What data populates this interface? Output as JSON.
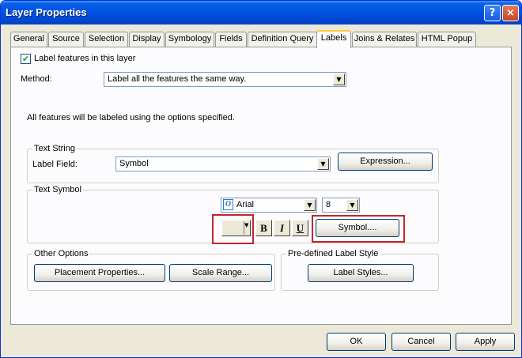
{
  "window": {
    "title": "Layer Properties"
  },
  "titlebar_buttons": {
    "help": "?",
    "close": "×"
  },
  "tabs": [
    {
      "label": "General"
    },
    {
      "label": "Source"
    },
    {
      "label": "Selection"
    },
    {
      "label": "Display"
    },
    {
      "label": "Symbology"
    },
    {
      "label": "Fields"
    },
    {
      "label": "Definition Query"
    },
    {
      "label": "Labels",
      "active": true
    },
    {
      "label": "Joins & Relates"
    },
    {
      "label": "HTML Popup"
    }
  ],
  "labels_tab": {
    "label_features": {
      "label": "Label features in this layer",
      "checked": true,
      "check_glyph": "✔"
    },
    "method": {
      "label": "Method:",
      "value": "Label all the features the same way."
    },
    "info_text": "All features will be labeled using the options specified.",
    "text_string": {
      "title": "Text String",
      "label_field_label": "Label Field:",
      "label_field_value": "Symbol",
      "expression_button": "Expression..."
    },
    "text_symbol": {
      "title": "Text Symbol",
      "font_value": "Arial",
      "font_icon": "O",
      "size_value": "8",
      "bold": "B",
      "italic": "I",
      "underline": "U",
      "symbol_button": "Symbol...."
    },
    "other_options": {
      "title": "Other Options",
      "placement_button": "Placement Properties...",
      "scale_button": "Scale Range..."
    },
    "predefined": {
      "title": "Pre-defined Label Style",
      "label_styles_button": "Label Styles..."
    }
  },
  "footer": {
    "ok": "OK",
    "cancel": "Cancel",
    "apply": "Apply"
  },
  "arrow_glyph": "▼"
}
